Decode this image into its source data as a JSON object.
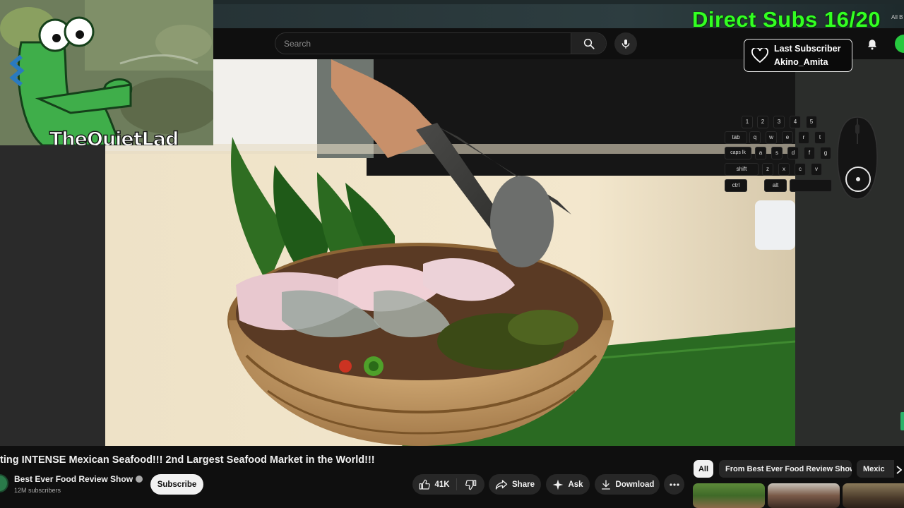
{
  "overlay": {
    "streamer_name": "TheQuietLad",
    "subs_counter": "Direct Subs 16/20",
    "corner_label": "All B",
    "last_subscriber": {
      "heading": "Last Subscriber",
      "name": "Akino_Amita"
    },
    "keyboard": {
      "row1": [
        "1",
        "2",
        "3",
        "4",
        "5"
      ],
      "row2": [
        "tab",
        "q",
        "w",
        "e",
        "r",
        "t"
      ],
      "row3": [
        "caps lk",
        "a",
        "s",
        "d",
        "f",
        "g"
      ],
      "row4": [
        "shift",
        "z",
        "x",
        "c",
        "v"
      ],
      "row5": [
        "ctrl",
        "alt"
      ]
    }
  },
  "header": {
    "search_placeholder": "Search"
  },
  "video": {
    "title": "ting INTENSE Mexican Seafood!!! 2nd Largest Seafood Market in the World!!!",
    "channel": "Best Ever Food Review Show",
    "subscribers": "12M subscribers",
    "subscribe_label": "Subscribe",
    "likes": "41K",
    "share_label": "Share",
    "ask_label": "Ask",
    "download_label": "Download"
  },
  "chips": [
    "All",
    "From Best Ever Food Review Show",
    "Mexic"
  ],
  "colors": {
    "subs_counter": "#33ff22",
    "background": "#0f0f0f",
    "button_bg": "#272727"
  }
}
